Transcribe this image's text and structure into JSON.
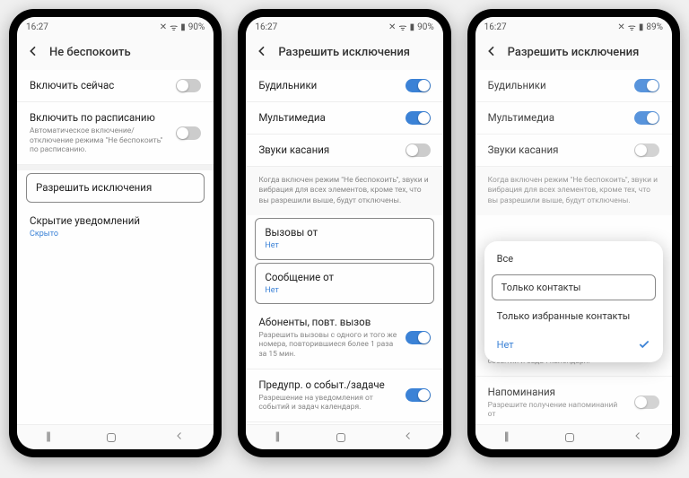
{
  "status": {
    "time": "16:27",
    "battery1": "90%",
    "battery3": "89%",
    "icons": "⟑ ⋮ ⋒"
  },
  "phone1": {
    "title": "Не беспокоить",
    "rows": {
      "enableNow": "Включить сейчас",
      "enableSchedule": "Включить по расписанию",
      "enableScheduleSub": "Автоматическое включение/отключение режима \"Не беспокоить\" по расписанию.",
      "allowExceptions": "Разрешить исключения",
      "hideNotifications": "Скрытие уведомлений",
      "hideNotificationsSub": "Скрыто"
    }
  },
  "phone2": {
    "title": "Разрешить исключения",
    "toggles": {
      "alarms": "Будильники",
      "media": "Мультимедиа",
      "touch": "Звуки касания"
    },
    "desc": "Когда включен режим \"Не беспокоить\", звуки и вибрация для всех элементов, кроме тех, что вы разрешили выше, будут отключены.",
    "callsFrom": "Вызовы от",
    "callsFromSub": "Нет",
    "msgFrom": "Сообщение от",
    "msgFromSub": "Нет",
    "repeat": "Абоненты, повт. вызов",
    "repeatSub": "Разрешить вызовы с одного и того же номера, повторившиеся более 1 раза за 15 мин.",
    "events": "Предупр. о событ./задаче",
    "eventsSub": "Разрешение на уведомления от событий и задач календаря.",
    "reminders": "Напоминания",
    "remindersSub": "Разрешите получение напоминаний от"
  },
  "phone3": {
    "popup": {
      "all": "Все",
      "onlyContacts": "Только контакты",
      "onlyFavorites": "Только избранные контакты",
      "none": "Нет"
    }
  }
}
